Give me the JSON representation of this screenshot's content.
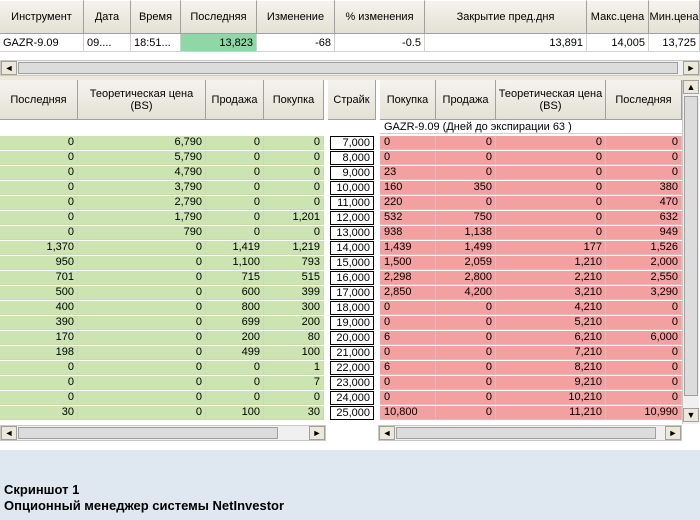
{
  "quote": {
    "headers": [
      "Инструмент",
      "Дата",
      "Время",
      "Последняя",
      "Изменение",
      "% изменения",
      "Закрытие пред.дня",
      "Макс.цена",
      "Мин.цена"
    ],
    "row": [
      "GAZR-9.09",
      "09....",
      "18:51...",
      "13,823",
      "-68",
      "-0.5",
      "13,891",
      "14,005",
      "13,725"
    ]
  },
  "desk": {
    "left_headers": [
      "Последняя",
      "Теоретическая цена (BS)",
      "Продажа",
      "Покупка"
    ],
    "strike_header": "Страйк",
    "right_headers": [
      "Покупка",
      "Продажа",
      "Теоретическая цена (BS)",
      "Последняя"
    ],
    "info": "GAZR-9.09 (Дней до экспирации 63 )",
    "rows": [
      {
        "l": [
          "0",
          "6,790",
          "0",
          "0"
        ],
        "strike": "7,000",
        "r": [
          "0",
          "0",
          "0",
          "0"
        ]
      },
      {
        "l": [
          "0",
          "5,790",
          "0",
          "0"
        ],
        "strike": "8,000",
        "r": [
          "0",
          "0",
          "0",
          "0"
        ]
      },
      {
        "l": [
          "0",
          "4,790",
          "0",
          "0"
        ],
        "strike": "9,000",
        "r": [
          "23",
          "0",
          "0",
          "0"
        ]
      },
      {
        "l": [
          "0",
          "3,790",
          "0",
          "0"
        ],
        "strike": "10,000",
        "r": [
          "160",
          "350",
          "0",
          "380"
        ]
      },
      {
        "l": [
          "0",
          "2,790",
          "0",
          "0"
        ],
        "strike": "11,000",
        "r": [
          "220",
          "0",
          "0",
          "470"
        ]
      },
      {
        "l": [
          "0",
          "1,790",
          "0",
          "1,201"
        ],
        "strike": "12,000",
        "r": [
          "532",
          "750",
          "0",
          "632"
        ]
      },
      {
        "l": [
          "0",
          "790",
          "0",
          "0"
        ],
        "strike": "13,000",
        "r": [
          "938",
          "1,138",
          "0",
          "949"
        ]
      },
      {
        "l": [
          "1,370",
          "0",
          "1,419",
          "1,219"
        ],
        "strike": "14,000",
        "r": [
          "1,439",
          "1,499",
          "177",
          "1,526"
        ]
      },
      {
        "l": [
          "950",
          "0",
          "1,100",
          "793"
        ],
        "strike": "15,000",
        "r": [
          "1,500",
          "2,059",
          "1,210",
          "2,000"
        ]
      },
      {
        "l": [
          "701",
          "0",
          "715",
          "515"
        ],
        "strike": "16,000",
        "r": [
          "2,298",
          "2,800",
          "2,210",
          "2,550"
        ]
      },
      {
        "l": [
          "500",
          "0",
          "600",
          "399"
        ],
        "strike": "17,000",
        "r": [
          "2,850",
          "4,200",
          "3,210",
          "3,290"
        ]
      },
      {
        "l": [
          "400",
          "0",
          "800",
          "300"
        ],
        "strike": "18,000",
        "r": [
          "0",
          "0",
          "4,210",
          "0"
        ]
      },
      {
        "l": [
          "390",
          "0",
          "699",
          "200"
        ],
        "strike": "19,000",
        "r": [
          "0",
          "0",
          "5,210",
          "0"
        ]
      },
      {
        "l": [
          "170",
          "0",
          "200",
          "80"
        ],
        "strike": "20,000",
        "r": [
          "6",
          "0",
          "6,210",
          "6,000"
        ]
      },
      {
        "l": [
          "198",
          "0",
          "499",
          "100"
        ],
        "strike": "21,000",
        "r": [
          "0",
          "0",
          "7,210",
          "0"
        ]
      },
      {
        "l": [
          "0",
          "0",
          "0",
          "1"
        ],
        "strike": "22,000",
        "r": [
          "6",
          "0",
          "8,210",
          "0"
        ]
      },
      {
        "l": [
          "0",
          "0",
          "0",
          "7"
        ],
        "strike": "23,000",
        "r": [
          "0",
          "0",
          "9,210",
          "0"
        ]
      },
      {
        "l": [
          "0",
          "0",
          "0",
          "0"
        ],
        "strike": "24,000",
        "r": [
          "0",
          "0",
          "10,210",
          "0"
        ]
      },
      {
        "l": [
          "30",
          "0",
          "100",
          "30"
        ],
        "strike": "25,000",
        "r": [
          "10,800",
          "0",
          "11,210",
          "10,990"
        ]
      }
    ]
  },
  "caption": {
    "line1": "Скриншот 1",
    "line2": "Опционный менеджер системы NetInvestor"
  },
  "icons": {
    "left": "◄",
    "right": "►",
    "up": "▲",
    "down": "▼"
  }
}
